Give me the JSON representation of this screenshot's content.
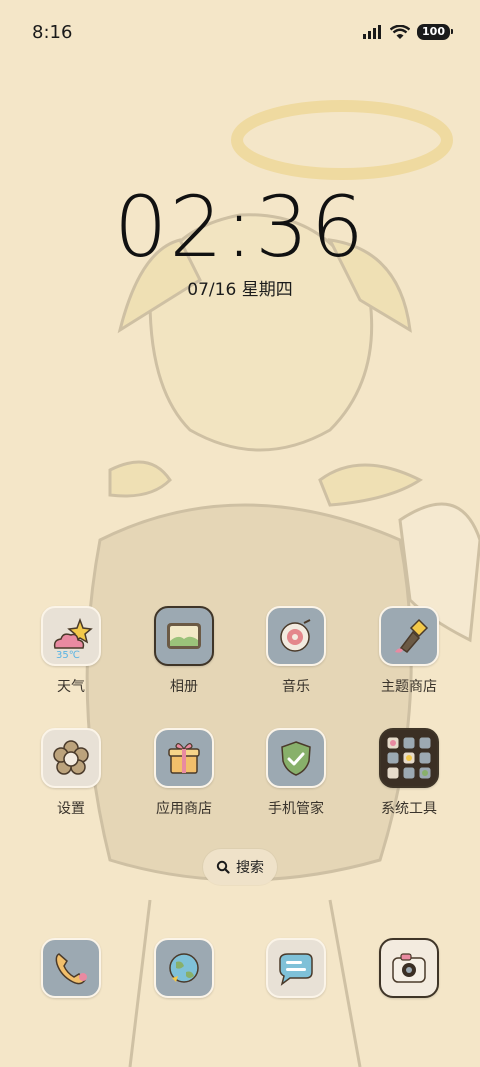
{
  "status_bar": {
    "time": "8:16",
    "battery": "100"
  },
  "lockclock": {
    "time": "02:36",
    "date": "07/16 星期四"
  },
  "apps": [
    {
      "label": "天气",
      "icon": "weather-icon",
      "temp": "35℃"
    },
    {
      "label": "相册",
      "icon": "gallery-icon"
    },
    {
      "label": "音乐",
      "icon": "music-icon"
    },
    {
      "label": "主题商店",
      "icon": "theme-store-icon"
    },
    {
      "label": "设置",
      "icon": "settings-icon"
    },
    {
      "label": "应用商店",
      "icon": "app-store-icon"
    },
    {
      "label": "手机管家",
      "icon": "security-icon"
    },
    {
      "label": "系统工具",
      "icon": "system-tools-folder-icon"
    }
  ],
  "search": {
    "label": "搜索"
  },
  "dock": [
    {
      "icon": "phone-icon"
    },
    {
      "icon": "browser-icon"
    },
    {
      "icon": "messages-icon"
    },
    {
      "icon": "camera-icon"
    }
  ],
  "colors": {
    "background": "#f4e6c8",
    "icon_tile": "#9ca9b2",
    "text": "#3a342c"
  }
}
